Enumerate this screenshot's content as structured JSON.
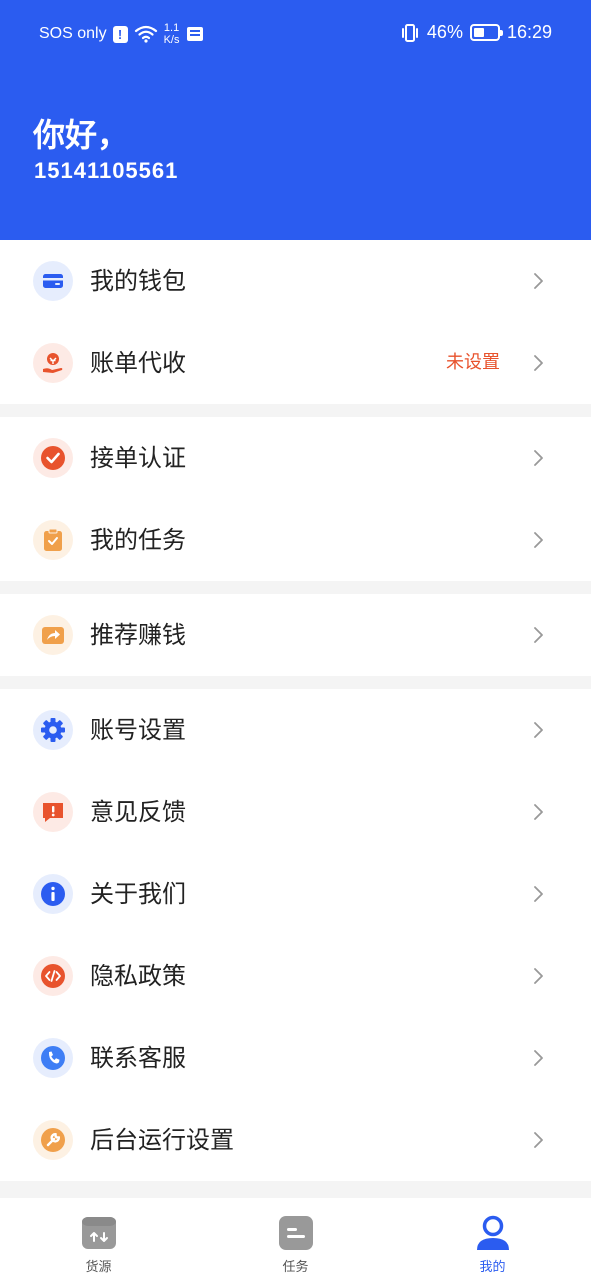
{
  "status_bar": {
    "carrier": "SOS only",
    "net_speed_value": "1.1",
    "net_speed_unit": "K/s",
    "battery_percent": "46%",
    "battery_level": 0.46,
    "time": "16:29"
  },
  "header": {
    "greeting": "你好，",
    "phone": "15141105561",
    "bg_color": "#2b5cf0"
  },
  "menu": {
    "wallet": {
      "label": "我的钱包",
      "icon": "wallet-icon"
    },
    "bill_collection": {
      "label": "账单代收",
      "value": "未设置",
      "icon": "collect-payment-icon"
    },
    "order_certification": {
      "label": "接单认证",
      "icon": "check-circle-icon"
    },
    "my_tasks": {
      "label": "我的任务",
      "icon": "clipboard-check-icon"
    },
    "referral": {
      "label": "推荐赚钱",
      "icon": "share-icon"
    },
    "account_settings": {
      "label": "账号设置",
      "icon": "gear-icon"
    },
    "feedback": {
      "label": "意见反馈",
      "icon": "feedback-icon"
    },
    "about_us": {
      "label": "关于我们",
      "icon": "info-icon"
    },
    "privacy": {
      "label": "隐私政策",
      "icon": "code-icon"
    },
    "customer_service": {
      "label": "联系客服",
      "icon": "phone-icon"
    },
    "background_run": {
      "label": "后台运行设置",
      "icon": "wrench-icon"
    }
  },
  "tabbar": {
    "tabs": [
      {
        "label": "货源",
        "icon": "cargo-source-icon",
        "active": false
      },
      {
        "label": "任务",
        "icon": "task-icon",
        "active": false
      },
      {
        "label": "我的",
        "icon": "profile-icon",
        "active": true
      }
    ]
  },
  "colors": {
    "accent": "#2b5cf0",
    "warning": "#e8532d",
    "orange": "#f0a04b"
  }
}
